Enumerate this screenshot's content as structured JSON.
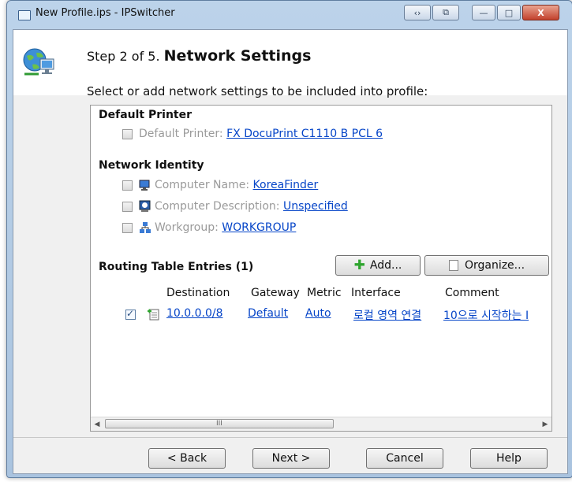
{
  "window": {
    "title": "New Profile.ips - IPSwitcher",
    "controls": [
      "‹›",
      "⧉",
      "—",
      "□",
      "X"
    ]
  },
  "header": {
    "step_label": "Step 2 of 5.",
    "step_title": "Network Settings",
    "instruction": "Select or add network settings to be included into profile:"
  },
  "default_printer": {
    "section_title": "Default Printer",
    "label": "Default Printer:",
    "value": "FX DocuPrint C1110 B PCL 6",
    "checked": false
  },
  "network_identity": {
    "section_title": "Network Identity",
    "items": [
      {
        "label": "Computer Name:",
        "value": "KoreaFinder",
        "icon": "computer-icon",
        "checked": false
      },
      {
        "label": "Computer Description:",
        "value": "Unspecified",
        "icon": "description-icon",
        "checked": false
      },
      {
        "label": "Workgroup:",
        "value": "WORKGROUP",
        "icon": "workgroup-icon",
        "checked": false
      }
    ]
  },
  "routing": {
    "section_title": "Routing Table Entries (1)",
    "add_label": "Add...",
    "organize_label": "Organize...",
    "columns": [
      "Destination",
      "Gateway",
      "Metric",
      "Interface",
      "Comment"
    ],
    "rows": [
      {
        "destination": "10.0.0.0/8",
        "gateway": "Default",
        "metric": "Auto",
        "interface": "로컬 영역 연결",
        "comment": "10으로 시작하는 I",
        "checked": true
      }
    ]
  },
  "scrollbar": {
    "left_arrow": "◀",
    "right_arrow": "▶",
    "grip": "III"
  },
  "footer": {
    "back_label": "< Back",
    "next_label": "Next >",
    "cancel_label": "Cancel",
    "help_label": "Help"
  }
}
